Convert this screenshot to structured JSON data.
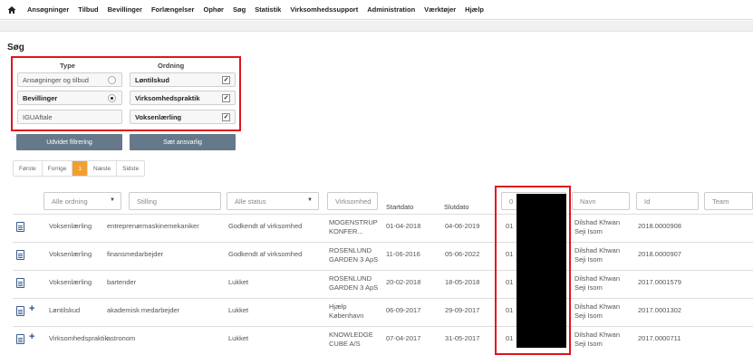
{
  "nav": {
    "items": [
      "Ansøgninger",
      "Tilbud",
      "Bevillinger",
      "Forlængelser",
      "Ophør",
      "Søg",
      "Statistik",
      "Virksomhedssupport",
      "Administration",
      "Værktøjer",
      "Hjælp"
    ]
  },
  "page": {
    "title": "Søg"
  },
  "filter": {
    "type_heading": "Type",
    "ordning_heading": "Ordning",
    "type_options": [
      {
        "label": "Ansøgninger og tilbud",
        "selected": false
      },
      {
        "label": "Bevillinger",
        "selected": true
      },
      {
        "label": "IGUAftale",
        "selected": false
      }
    ],
    "ordning_options": [
      {
        "label": "Løntilskud",
        "checked": true
      },
      {
        "label": "Virksomhedspraktik",
        "checked": true
      },
      {
        "label": "Voksenlærling",
        "checked": true
      }
    ],
    "check_glyph": "✓"
  },
  "buttons": {
    "udvidet": "Udvidet filtrering",
    "ansvarlig": "Sæt ansvarlig"
  },
  "pager": {
    "first": "Første",
    "prev": "Forrige",
    "current": "1",
    "next": "Næste",
    "last": "Sidste"
  },
  "filters_row": {
    "ordning": "Alle ordning",
    "stilling": "Stilling",
    "status": "Alle status",
    "virksomhed": "Virksomhed",
    "startdato": "Startdato",
    "slutdato": "Slutdato",
    "cpr_partial": "0",
    "navn": "Navn",
    "id": "Id",
    "team": "Team",
    "caret": "▼"
  },
  "rows": [
    {
      "plus": false,
      "ordning": "Voksenlærling",
      "stilling": "entreprenørmaskinemekaniker",
      "status": "Godkendt af virksomhed",
      "virksomhed1": "MOGENSTRUP",
      "virksomhed2": "KONFER...",
      "start": "01-04-2018",
      "slut": "04-06-2019",
      "cpr": "01",
      "navn1": "Dilshad Khwan",
      "navn2": "Seji Isom",
      "id": "2018.0000908"
    },
    {
      "plus": false,
      "ordning": "Voksenlærling",
      "stilling": "finansmedarbejder",
      "status": "Godkendt af virksomhed",
      "virksomhed1": "ROSENLUND",
      "virksomhed2": "GARDEN 3 ApS",
      "start": "11-06-2016",
      "slut": "05-06-2022",
      "cpr": "01",
      "navn1": "Dilshad Khwan",
      "navn2": "Seji Isom",
      "id": "2018.0000907"
    },
    {
      "plus": false,
      "ordning": "Voksenlærling",
      "stilling": "bartender",
      "status": "Lukket",
      "virksomhed1": "ROSENLUND",
      "virksomhed2": "GARDEN 3 ApS",
      "start": "20-02-2018",
      "slut": "18-05-2018",
      "cpr": "01",
      "navn1": "Dilshad Khwan",
      "navn2": "Seji Isom",
      "id": "2017.0001579"
    },
    {
      "plus": true,
      "ordning": "Løntilskud",
      "stilling": "akademisk medarbejder",
      "status": "Lukket",
      "virksomhed1": "Hjælp",
      "virksomhed2": "København",
      "start": "06-09-2017",
      "slut": "29-09-2017",
      "cpr": "01",
      "navn1": "Dilshad Khwan",
      "navn2": "Seji Isom",
      "id": "2017.0001302"
    },
    {
      "plus": true,
      "ordning": "Virksomhedspraktik",
      "stilling": "astronom",
      "status": "Lukket",
      "virksomhed1": "KNOWLEDGE",
      "virksomhed2": "CUBE A/S",
      "start": "07-04-2017",
      "slut": "31-05-2017",
      "cpr": "01",
      "navn1": "Dilshad Khwan",
      "navn2": "Seji Isom",
      "id": "2017.0000711"
    }
  ]
}
